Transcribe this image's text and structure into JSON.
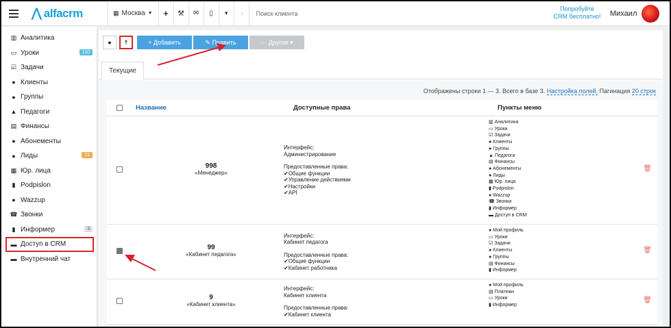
{
  "topbar": {
    "logo_text": "alfacrm",
    "branch": "Москва",
    "search_placeholder": "Поиск клиента",
    "try_line1": "Попробуйте",
    "try_line2": "CRM бесплатно!",
    "user_name": "Михаил"
  },
  "sidebar": {
    "items": [
      {
        "icon": "chart-icon",
        "glyph": "▥",
        "label": "Аналитика"
      },
      {
        "icon": "calendar-icon",
        "glyph": "▭",
        "label": "Уроки",
        "badge": "110",
        "badge_color": "#5bc0de"
      },
      {
        "icon": "tasks-icon",
        "glyph": "☑",
        "label": "Задачи"
      },
      {
        "icon": "user-icon",
        "glyph": "●",
        "label": "Клиенты"
      },
      {
        "icon": "users-icon",
        "glyph": "●",
        "label": "Группы"
      },
      {
        "icon": "graduation-cap-icon",
        "glyph": "▲",
        "label": "Педагоги"
      },
      {
        "icon": "money-icon",
        "glyph": "▤",
        "label": "Финансы"
      },
      {
        "icon": "ticket-icon",
        "glyph": "●",
        "label": "Абонементы"
      },
      {
        "icon": "leads-icon",
        "glyph": "●",
        "label": "Лиды",
        "badge": "21",
        "badge_color": "#f0ad4e"
      },
      {
        "icon": "building-icon",
        "glyph": "▦",
        "label": "Юр. лица"
      },
      {
        "icon": "document-icon",
        "glyph": "▮",
        "label": "Podpislon"
      },
      {
        "icon": "whatsapp-icon",
        "glyph": "●",
        "label": "Wazzup"
      },
      {
        "icon": "phone-icon",
        "glyph": "☎",
        "label": "Звонки"
      },
      {
        "icon": "book-icon",
        "glyph": "▮",
        "label": "Информер",
        "badge": "3",
        "badge_color": "#e0e0e0"
      },
      {
        "icon": "lock-icon",
        "glyph": "▬",
        "label": "Доступ в CRM",
        "highlight": true
      },
      {
        "icon": "chat-icon",
        "glyph": "▬",
        "label": "Внутренний чат"
      }
    ]
  },
  "toolbar": {
    "add_label": "+ Добавить",
    "edit_label": "✎ Править",
    "other_label": "··· Другое ▾"
  },
  "tabs": {
    "current": "Текущие"
  },
  "info": {
    "shown": "Отображены строки 1 — 3. Всего в базе 3.",
    "fields_link": "Настройка полей.",
    "pagination_label": "Пагинация",
    "pagination_link": "20 строк"
  },
  "table": {
    "headers": {
      "name": "Название",
      "rights": "Доступные права",
      "menu": "Пункты меню"
    },
    "rows": [
      {
        "checked": false,
        "num": "998",
        "name": "«Менеджер»",
        "iface_label": "Интерфейс:",
        "iface": "Администрирование",
        "granted_label": "Предоставленные права:",
        "granted": [
          "✔Общие функции",
          "✔Управление действиями",
          "✔Настройки",
          "✔API"
        ],
        "menu": [
          "▥ Аналитика",
          "▭ Уроки",
          "☑ Задачи",
          "● Клиенты",
          "● Группы",
          "▲ Педагоги",
          "▤ Финансы",
          "● Абонементы",
          "● Лиды",
          "▦ Юр. лица",
          "▮ Podpislon",
          "● Wazzup",
          "☎ Звонки",
          "▮ Информер",
          "▬ Доступ в CRM"
        ]
      },
      {
        "checked": true,
        "num": "99",
        "name": "«Кабинет педагога»",
        "iface_label": "Интерфейс:",
        "iface": "Кабинет педагога",
        "granted_label": "Предоставленные права:",
        "granted": [
          "✔Общие функции",
          "✔Кабинет работника"
        ],
        "menu": [
          "● Мой профиль",
          "▭ Уроки",
          "☑ Задачи",
          "● Клиенты",
          "● Группы",
          "▤ Финансы",
          "▮ Информер"
        ]
      },
      {
        "checked": false,
        "num": "9",
        "name": "«Кабинет клиента»",
        "iface_label": "Интерфейс:",
        "iface": "Кабинет клиента",
        "granted_label": "Предоставленные права:",
        "granted": [
          "✔Кабинет клиента"
        ],
        "menu": [
          "● Мой профиль",
          "▤ Платежи",
          "▭ Уроки",
          "▮ Информер"
        ]
      }
    ]
  },
  "colors": {
    "accent": "#4aa3e0",
    "highlight": "#d9232d",
    "link": "#1a6fb5"
  }
}
